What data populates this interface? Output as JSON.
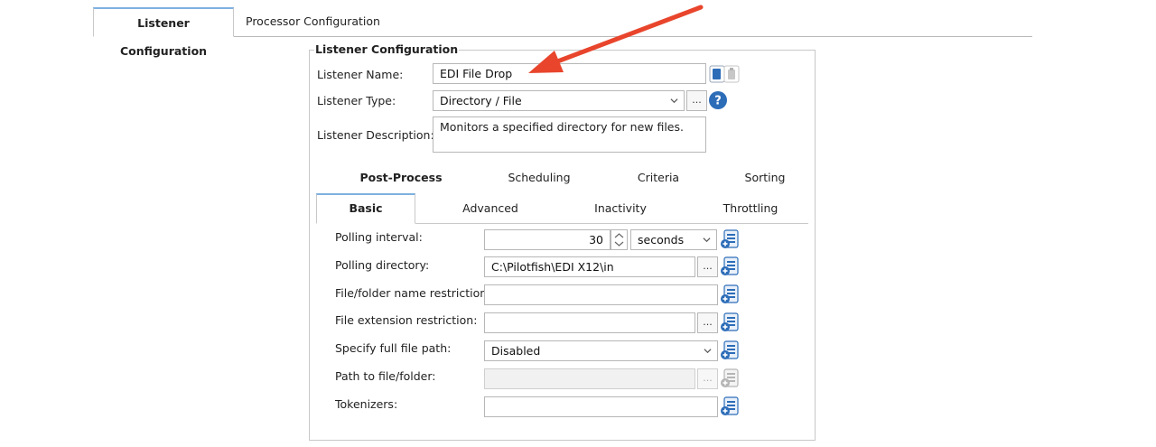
{
  "top_tabs": {
    "listener_configuration": "Listener Configuration",
    "processor_configuration": "Processor Configuration"
  },
  "group": {
    "legend": "Listener Configuration",
    "listener_name_label": "Listener Name:",
    "listener_name_value": "EDI File Drop",
    "listener_type_label": "Listener Type:",
    "listener_type_value": "Directory / File",
    "listener_description_label": "Listener Description:",
    "listener_description_value": "Monitors a specified directory for new files.",
    "browse_label": "...",
    "help_label": "?"
  },
  "subtabs_row1": [
    "Post-Process",
    "Scheduling",
    "Criteria",
    "Sorting"
  ],
  "subtabs_row2": [
    "Basic",
    "Advanced",
    "Inactivity",
    "Throttling"
  ],
  "basic": {
    "polling_interval_label": "Polling interval:",
    "polling_interval_value": "30",
    "polling_interval_unit": "seconds",
    "polling_directory_label": "Polling directory:",
    "polling_directory_value": "C:\\Pilotfish\\EDI X12\\in",
    "name_restriction_label": "File/folder name restriction:",
    "name_restriction_value": "",
    "extension_restriction_label": "File extension restriction:",
    "extension_restriction_value": "",
    "full_path_label": "Specify full file path:",
    "full_path_value": "Disabled",
    "path_label": "Path to file/folder:",
    "path_value": "",
    "tokenizers_label": "Tokenizers:",
    "tokenizers_value": ""
  },
  "colors": {
    "accent": "#2d6db8",
    "arrow": "#e8452c",
    "tab_highlight": "#7fb0e0"
  }
}
